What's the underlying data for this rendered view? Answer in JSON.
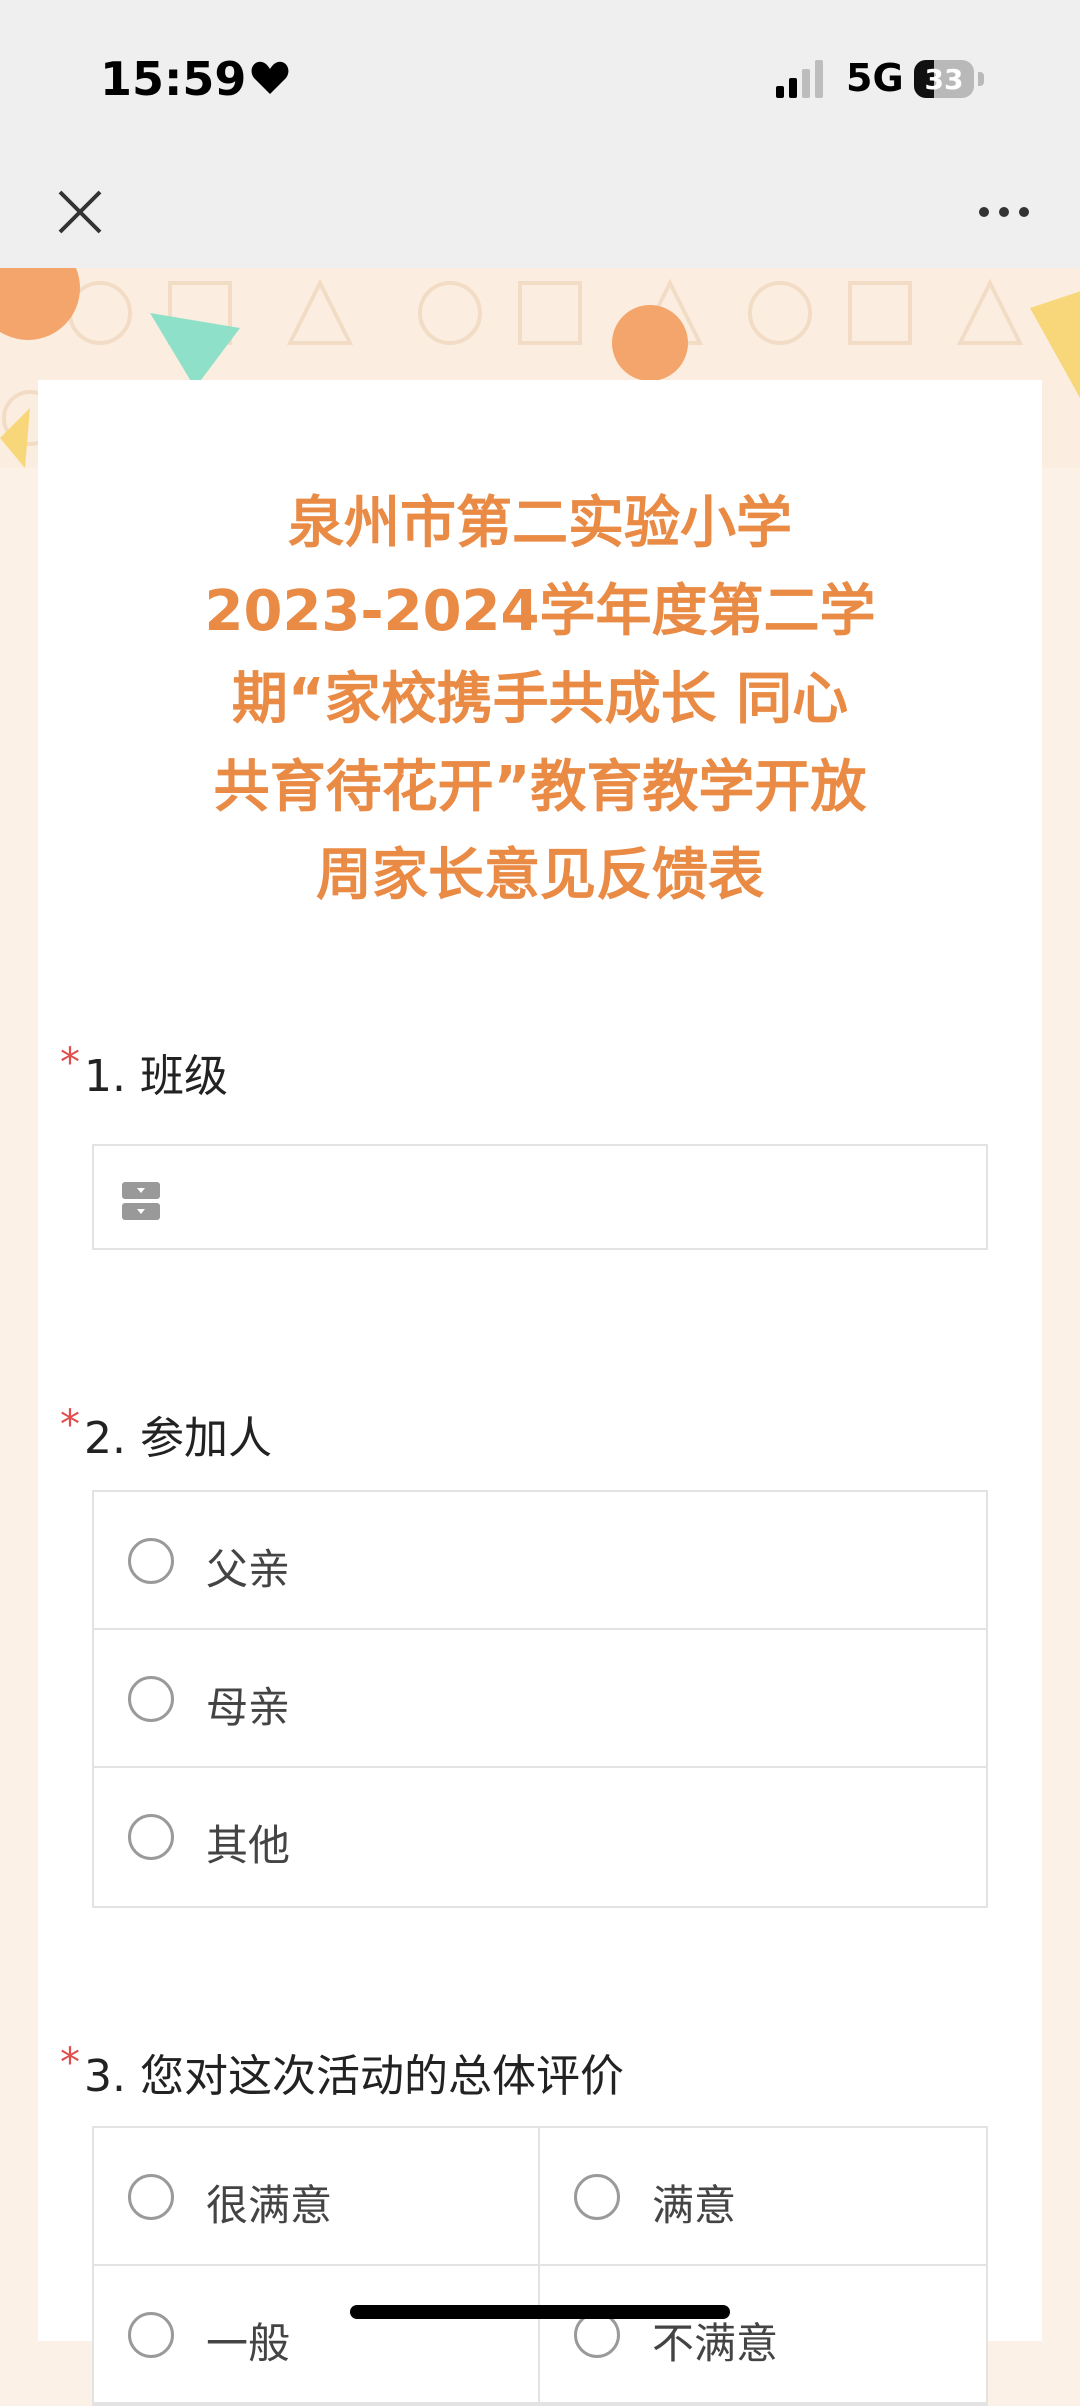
{
  "status_bar": {
    "time": "15:59",
    "network": "5G",
    "battery": "33"
  },
  "nav": {
    "close_icon": "close-icon",
    "more_icon": "more-icon"
  },
  "form": {
    "title_lines": [
      "泉州市第二实验小学",
      "2023-2024学年度第二学",
      "期“家校携手共成长 同心",
      "共育待花开”教育教学开放",
      "周家长意见反馈表"
    ],
    "required_mark": "*",
    "q1": {
      "label": "1. 班级",
      "value": ""
    },
    "q2": {
      "label": "2. 参加人",
      "options": [
        "父亲",
        "母亲",
        "其他"
      ]
    },
    "q3": {
      "label": "3. 您对这次活动的总体评价",
      "options": [
        "很满意",
        "满意",
        "一般",
        "不满意"
      ]
    }
  },
  "colors": {
    "title": "#e98a45",
    "required": "#e04e4e",
    "accent_orange": "#f4a56b",
    "accent_teal": "#8fe0c8",
    "accent_yellow": "#f7d77a"
  }
}
